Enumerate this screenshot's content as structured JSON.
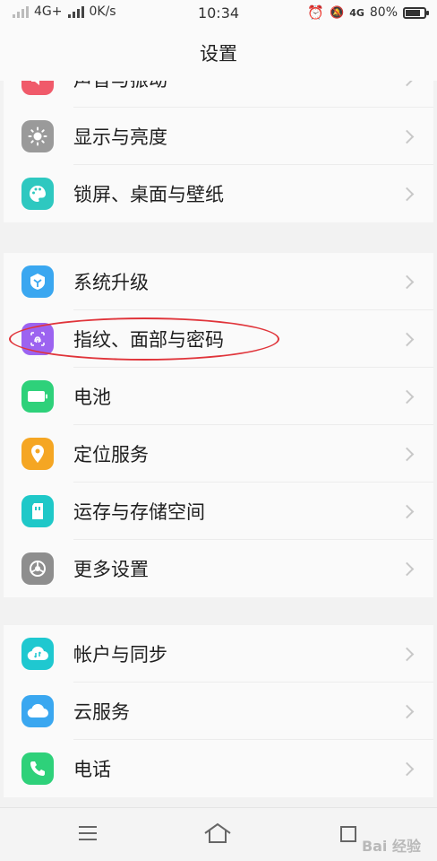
{
  "status_bar": {
    "network": "4G+",
    "speed": "0K/s",
    "time": "10:34",
    "volte": "4G",
    "battery": "80%",
    "battery_level": 80
  },
  "header": {
    "title": "设置"
  },
  "sections": [
    {
      "items": [
        {
          "label": "声音与振动",
          "icon": "sound-icon",
          "color": "#f05a6a"
        },
        {
          "label": "显示与亮度",
          "icon": "brightness-icon",
          "color": "#9a9a9a"
        },
        {
          "label": "锁屏、桌面与壁纸",
          "icon": "palette-icon",
          "color": "#2ec8c0"
        }
      ]
    },
    {
      "items": [
        {
          "label": "系统升级",
          "icon": "system-update-icon",
          "color": "#3aa7f0"
        },
        {
          "label": "指纹、面部与密码",
          "icon": "fingerprint-icon",
          "color": "#9c63f0"
        },
        {
          "label": "电池",
          "icon": "battery-icon",
          "color": "#2ed17a"
        },
        {
          "label": "定位服务",
          "icon": "location-icon",
          "color": "#f5a623"
        },
        {
          "label": "运存与存储空间",
          "icon": "storage-icon",
          "color": "#1fc8c8"
        },
        {
          "label": "更多设置",
          "icon": "gear-icon",
          "color": "#8e8e8e"
        }
      ]
    },
    {
      "items": [
        {
          "label": "帐户与同步",
          "icon": "cloud-sync-icon",
          "color": "#1fc8d0"
        },
        {
          "label": "云服务",
          "icon": "cloud-icon",
          "color": "#3aa7f0"
        },
        {
          "label": "电话",
          "icon": "phone-icon",
          "color": "#2ed17a"
        }
      ]
    }
  ],
  "nav": {
    "menu": "menu-icon",
    "home": "home-icon",
    "back": "back-icon"
  },
  "watermark": "Bai 经验"
}
